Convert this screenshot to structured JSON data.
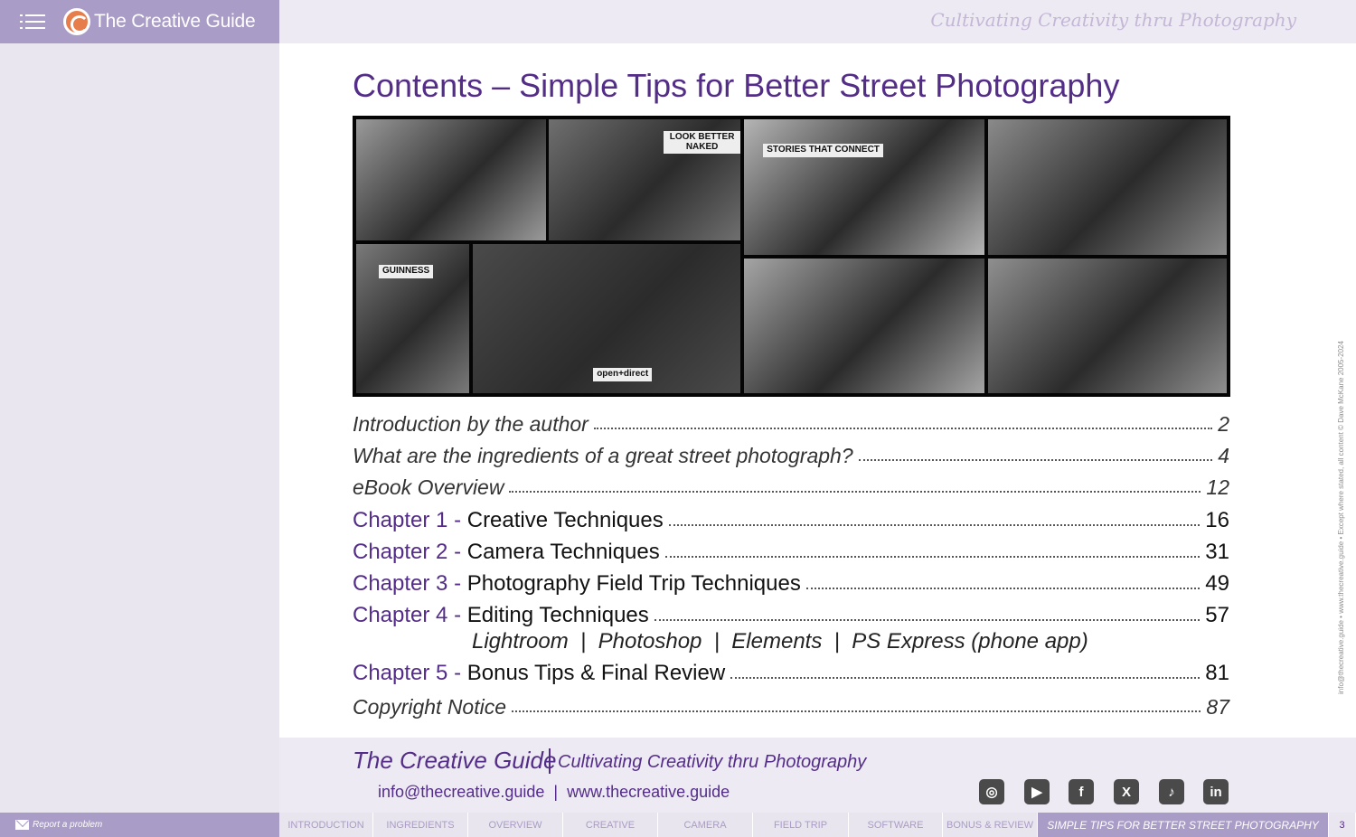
{
  "header": {
    "brand": "The Creative Guide",
    "tagline": "Cultivating Creativity thru Photography"
  },
  "page": {
    "title": "Contents – Simple Tips for Better Street Photography"
  },
  "collage": {
    "photos": [
      {
        "name": "portable-toilets-photo",
        "tone": "#9a9a9a",
        "caption": ""
      },
      {
        "name": "street-poster-photo",
        "tone": "#6f6f6f",
        "caption": "LOOK BETTER NAKED"
      },
      {
        "name": "stories-sign-photo",
        "tone": "#b5b5b5",
        "caption": "STORIES THAT CONNECT"
      },
      {
        "name": "statue-tourist-photo",
        "tone": "#8a8a8a",
        "caption": ""
      },
      {
        "name": "guinness-doorway-photo",
        "tone": "#7a7a7a",
        "caption": "GUINNESS"
      },
      {
        "name": "kiss-celebrity-photo",
        "tone": "#4a4a4a",
        "caption": "open+direct"
      },
      {
        "name": "street-artist-photo",
        "tone": "#a5a5a5",
        "caption": ""
      },
      {
        "name": "horse-carriage-photo",
        "tone": "#8f8f8f",
        "caption": ""
      }
    ]
  },
  "toc": {
    "intro": {
      "title": "Introduction by the author",
      "page": "2"
    },
    "ingredients": {
      "title": "What are the ingredients of a great street photograph?",
      "page": "4"
    },
    "overview": {
      "title": "eBook Overview",
      "page": "12"
    },
    "chapters": [
      {
        "num": "Chapter 1 -",
        "title": "Creative Techniques",
        "page": "16"
      },
      {
        "num": "Chapter 2 -",
        "title": "Camera Techniques",
        "page": "31"
      },
      {
        "num": "Chapter 3 -",
        "title": "Photography Field Trip Techniques",
        "page": "49"
      },
      {
        "num": "Chapter 4 -",
        "title": "Editing Techniques",
        "page": "57"
      },
      {
        "num": "Chapter 5 -",
        "title": "Bonus Tips & Final Review",
        "page": "81"
      }
    ],
    "chapter4_sub": "Lightroom  |  Photoshop  |  Elements  |  PS Express (phone app)",
    "copyright": {
      "title": "Copyright Notice",
      "page": "87"
    }
  },
  "side_credit": "info@thecreative.guide  •  www.thecreative.guide  •  Except where stated, all content © Dave McKane 2005-2024",
  "footer": {
    "brand": "The Creative Guide",
    "tagline": "Cultivating Creativity thru Photography",
    "contact": "info@thecreative.guide  |  www.thecreative.guide",
    "social": [
      {
        "name": "instagram-icon",
        "glyph": "◎"
      },
      {
        "name": "youtube-icon",
        "glyph": "▶"
      },
      {
        "name": "facebook-icon",
        "glyph": "f"
      },
      {
        "name": "x-icon",
        "glyph": "X"
      },
      {
        "name": "tiktok-icon",
        "glyph": "♪"
      },
      {
        "name": "linkedin-icon",
        "glyph": "in"
      }
    ]
  },
  "bottom": {
    "report": "Report a problem",
    "tabs": [
      "INTRODUCTION",
      "INGREDIENTS",
      "OVERVIEW",
      "CREATIVE",
      "CAMERA",
      "FIELD TRIP",
      "SOFTWARE",
      "BONUS & REVIEW"
    ],
    "current": "SIMPLE TIPS FOR BETTER STREET PHOTOGRAPHY",
    "page_number": "3"
  }
}
